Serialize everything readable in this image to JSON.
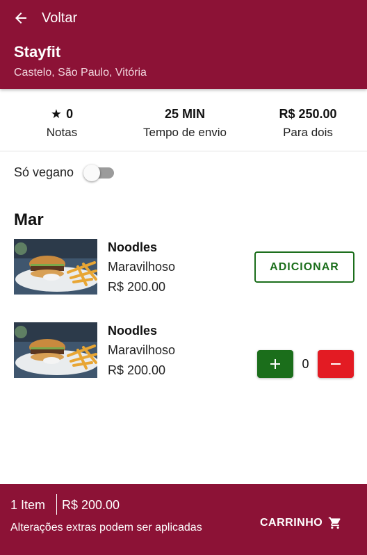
{
  "header": {
    "back_label": "Voltar",
    "store_name": "Stayfit",
    "store_address": "Castelo, São Paulo, Vitória",
    "bg_color": "#8c1236"
  },
  "info": {
    "rating": "0",
    "rating_label": "Notas",
    "delivery_time": "25 MIN",
    "delivery_label": "Tempo de envio",
    "price_for_two": "R$ 250.00",
    "price_label": "Para dois"
  },
  "filter": {
    "vegan_label": "Só vegano",
    "vegan_on": false
  },
  "section": {
    "title": "Mar"
  },
  "items": [
    {
      "name": "Noodles",
      "description": "Maravilhoso",
      "price": "R$ 200.00",
      "action_label": "ADICIONAR"
    },
    {
      "name": "Noodles",
      "description": "Maravilhoso",
      "price": "R$ 200.00",
      "quantity": "0"
    }
  ],
  "footer": {
    "item_count": "1 Item",
    "total": "R$ 200.00",
    "note": "Alterações extras podem ser aplicadas",
    "cart_label": "CARRINHO"
  },
  "icons": [
    "arrow-left-icon",
    "star-icon",
    "plus-icon",
    "minus-icon",
    "cart-icon"
  ],
  "colors": {
    "primary": "#8c1236",
    "add_green": "#1b6e1b",
    "remove_red": "#e31b23"
  }
}
